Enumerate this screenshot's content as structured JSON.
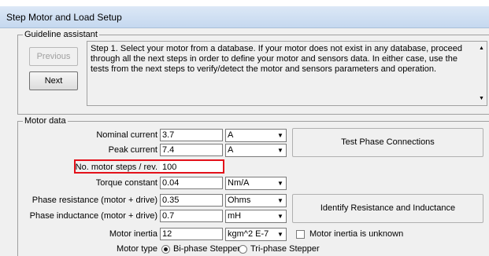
{
  "window": {
    "title": "Step Motor and Load Setup"
  },
  "guideline": {
    "legend": "Guideline assistant",
    "previous_label": "Previous",
    "next_label": "Next",
    "message": "Step 1. Select your motor from a database. If your motor does not exist in any database, proceed through all the next steps in order to define your motor and sensors data. In either case, use the tests from the next steps to verify/detect the motor and sensors parameters and operation."
  },
  "motor": {
    "legend": "Motor data",
    "nominal_current": {
      "label": "Nominal current",
      "value": "3.7",
      "unit": "A"
    },
    "peak_current": {
      "label": "Peak current",
      "value": "7.4",
      "unit": "A"
    },
    "steps": {
      "label": "No. motor steps / rev.",
      "value": "100"
    },
    "torque_constant": {
      "label": "Torque constant",
      "value": "0.04",
      "unit": "Nm/A"
    },
    "phase_resistance": {
      "label": "Phase resistance (motor + drive)",
      "value": "0.35",
      "unit": "Ohms"
    },
    "phase_inductance": {
      "label": "Phase inductance (motor + drive)",
      "value": "0.7",
      "unit": "mH"
    },
    "inertia": {
      "label": "Motor inertia",
      "value": "12",
      "unit": "kgm^2 E-7",
      "unknown_label": "Motor inertia is unknown"
    },
    "motor_type": {
      "label": "Motor type",
      "option1": "Bi-phase Stepper",
      "option2": "Tri-phase Stepper"
    },
    "test_phase_label": "Test Phase Connections",
    "identify_label": "Identify Resistance and Inductance"
  },
  "colors": {
    "highlight": "#e3111a"
  }
}
